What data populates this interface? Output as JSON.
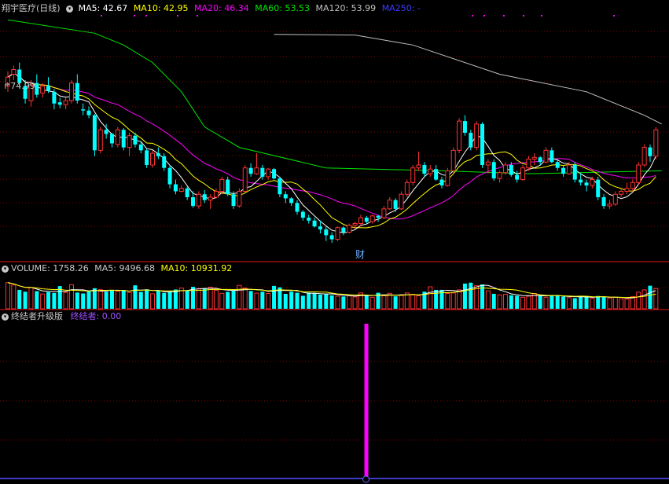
{
  "header": {
    "stock_name": "翔宇医疗",
    "period": "(日线)",
    "ma5": "MA5: 42.67",
    "ma10": "MA10: 42.95",
    "ma20": "MA20: 46.34",
    "ma60": "MA60: 53.53",
    "ma120": "MA120: 53.99",
    "ma250": "MA250: -"
  },
  "high_marker": "74.99",
  "cai_marker": "财",
  "volume_header": {
    "volume": "VOLUME: 1758.26",
    "ma5": "MA5: 9496.68",
    "ma10": "MA10: 10931.92"
  },
  "indicator_header": {
    "name": "终结者升级版",
    "value_label": "终结者: 0.00"
  },
  "colors": {
    "up": "#ff3232",
    "down": "#00ffff",
    "ma5": "#ffffff",
    "ma10": "#ffff00",
    "ma20": "#ff00ff",
    "ma60": "#00e600",
    "ma120": "#c0c0c0",
    "ma250": "#3c3cff",
    "signal": "#ff00ff"
  },
  "chart_data": {
    "type": "candlestick",
    "candles": [
      [
        64,
        66.5,
        63,
        65.5
      ],
      [
        66,
        67.5,
        65,
        66.8
      ],
      [
        66.8,
        68,
        64,
        64.5
      ],
      [
        64,
        65,
        61,
        61.8
      ],
      [
        61.5,
        65,
        60.5,
        64.2
      ],
      [
        64.5,
        66,
        62,
        62.5
      ],
      [
        62.8,
        64.5,
        62,
        64
      ],
      [
        64,
        65.5,
        62.8,
        63.2
      ],
      [
        63,
        63.5,
        60,
        61
      ],
      [
        61.2,
        62,
        60.2,
        60.8
      ],
      [
        60.8,
        62,
        60,
        61.5
      ],
      [
        61.5,
        65,
        61,
        64.5
      ],
      [
        64.5,
        66,
        61,
        61.5
      ],
      [
        60,
        61,
        59,
        59.8
      ],
      [
        59.8,
        60.5,
        58.5,
        59
      ],
      [
        59,
        59.2,
        52,
        53
      ],
      [
        53,
        57,
        52.5,
        56.5
      ],
      [
        56.5,
        57.5,
        55,
        55.8
      ],
      [
        55.8,
        56,
        53.5,
        54.2
      ],
      [
        54,
        57,
        53.5,
        56.5
      ],
      [
        56.5,
        56.8,
        53,
        53.5
      ],
      [
        53.5,
        56,
        52,
        55.5
      ],
      [
        55.5,
        56,
        53.5,
        54
      ],
      [
        54,
        54.5,
        52.5,
        53
      ],
      [
        53,
        53.3,
        50,
        50.5
      ],
      [
        50.5,
        53,
        50,
        52.5
      ],
      [
        52.5,
        53.5,
        51.5,
        52
      ],
      [
        52,
        52.5,
        49.5,
        50
      ],
      [
        50,
        50.5,
        46.5,
        47.2
      ],
      [
        47.2,
        48,
        45.5,
        46
      ],
      [
        46,
        47,
        45.8,
        46.5
      ],
      [
        46.5,
        46.8,
        44.5,
        45
      ],
      [
        45,
        46,
        43.2,
        43.5
      ],
      [
        43.5,
        46,
        43,
        45.5
      ],
      [
        45.5,
        46.2,
        44,
        44.5
      ],
      [
        44.5,
        45.5,
        43,
        45
      ],
      [
        45,
        46.5,
        44.8,
        46
      ],
      [
        46,
        48.5,
        45.5,
        48
      ],
      [
        48,
        48.5,
        45.2,
        45.5
      ],
      [
        45.5,
        46,
        43,
        43.5
      ],
      [
        43.5,
        46.5,
        43.2,
        46
      ],
      [
        46,
        50.5,
        45.8,
        50
      ],
      [
        50,
        50.8,
        48.5,
        49
      ],
      [
        49,
        52.5,
        48.8,
        50
      ],
      [
        50,
        50.5,
        48,
        48.5
      ],
      [
        48.5,
        50,
        48,
        49.8
      ],
      [
        49.8,
        50,
        48,
        48.2
      ],
      [
        48.2,
        48.5,
        45,
        45.5
      ],
      [
        45.5,
        46,
        44,
        44.8
      ],
      [
        44.8,
        45,
        43.5,
        44
      ],
      [
        44,
        44.5,
        42,
        42.5
      ],
      [
        42.5,
        42.8,
        41,
        41.5
      ],
      [
        41.5,
        42,
        40.5,
        41
      ],
      [
        41,
        41.5,
        39.8,
        40
      ],
      [
        40,
        41,
        38.8,
        39.5
      ],
      [
        39.5,
        40,
        37.5,
        38.5
      ],
      [
        38.5,
        39,
        37.2,
        37.8
      ],
      [
        37.8,
        40,
        37.5,
        39.8
      ],
      [
        39.8,
        40,
        38.5,
        39
      ],
      [
        39,
        40.5,
        38.8,
        40.2
      ],
      [
        40.2,
        40.8,
        39.5,
        40.5
      ],
      [
        40.5,
        42,
        40,
        41.5
      ],
      [
        41.5,
        41.8,
        40.5,
        40.8
      ],
      [
        40.8,
        42,
        40.5,
        41.8
      ],
      [
        41.8,
        42,
        40.8,
        41.5
      ],
      [
        41.5,
        43.5,
        41.2,
        43
      ],
      [
        43,
        45,
        42.8,
        44.5
      ],
      [
        44.5,
        44.8,
        42.5,
        43
      ],
      [
        43,
        46,
        42.8,
        45.5
      ],
      [
        45.5,
        48,
        45,
        47.5
      ],
      [
        47.5,
        50.5,
        47,
        50
      ],
      [
        50,
        52.8,
        49.5,
        50.5
      ],
      [
        50.5,
        51,
        48.5,
        49
      ],
      [
        49,
        50.5,
        48.5,
        49.8
      ],
      [
        49.8,
        50.5,
        47.8,
        48
      ],
      [
        48,
        48.5,
        46.5,
        47
      ],
      [
        47,
        50,
        46.8,
        49.5
      ],
      [
        49.5,
        53.5,
        49,
        53
      ],
      [
        53,
        58.5,
        52.5,
        58
      ],
      [
        58,
        59,
        55.5,
        56
      ],
      [
        56,
        56.5,
        53,
        53.5
      ],
      [
        53.5,
        58,
        53,
        57.5
      ],
      [
        57.5,
        57.8,
        50,
        50.5
      ],
      [
        50.5,
        51.5,
        49,
        51
      ],
      [
        51,
        51.5,
        47.8,
        48.2
      ],
      [
        48.2,
        49.5,
        47.5,
        49.2
      ],
      [
        49.2,
        51,
        48.8,
        50.5
      ],
      [
        50.5,
        51,
        48.5,
        48.8
      ],
      [
        48.8,
        49.5,
        47.5,
        48
      ],
      [
        48,
        50.5,
        47.8,
        50
      ],
      [
        50,
        52,
        49.5,
        51.5
      ],
      [
        51.5,
        52.5,
        50.5,
        51.8
      ],
      [
        51.8,
        52,
        50.5,
        51
      ],
      [
        51,
        53.5,
        50.8,
        53
      ],
      [
        53,
        53.5,
        50.8,
        51
      ],
      [
        51,
        51.5,
        49.5,
        50
      ],
      [
        50,
        50.5,
        48.5,
        49
      ],
      [
        49,
        51,
        48.8,
        50.5
      ],
      [
        50.5,
        51,
        47.5,
        48
      ],
      [
        48,
        49,
        47,
        47.5
      ],
      [
        47.5,
        48,
        46,
        47
      ],
      [
        47,
        48.5,
        46.5,
        48
      ],
      [
        48,
        48.5,
        44.5,
        45
      ],
      [
        45,
        45.5,
        43,
        43.5
      ],
      [
        43.5,
        44.5,
        43,
        43.8
      ],
      [
        43.8,
        46,
        43.5,
        45.5
      ],
      [
        45.5,
        46.5,
        45,
        46
      ],
      [
        46,
        47.5,
        45.5,
        46.5
      ],
      [
        46.5,
        48,
        46,
        47.5
      ],
      [
        47.5,
        51,
        47.2,
        50.5
      ],
      [
        50.5,
        54,
        50.2,
        53.5
      ],
      [
        53.5,
        54,
        51,
        52
      ],
      [
        52,
        57,
        51.5,
        56.5
      ]
    ],
    "volumes": [
      1.45,
      1.32,
      1.05,
      0.95,
      1.18,
      0.98,
      0.82,
      0.93,
      0.88,
      1.26,
      0.91,
      1.34,
      0.9,
      0.85,
      0.96,
      1.14,
      1.06,
      0.95,
      1.02,
      0.98,
      1.04,
      0.9,
      1.3,
      0.94,
      1.08,
      0.83,
      0.98,
      0.88,
      0.95,
      1.07,
      1.15,
      1.0,
      1.22,
      1.1,
      1.15,
      1.2,
      1.03,
      0.86,
      0.94,
      1.03,
      1.3,
      1.15,
      0.99,
      0.87,
      0.95,
      0.85,
      1.27,
      1.19,
      0.83,
      0.95,
      0.89,
      0.72,
      0.9,
      0.88,
      0.79,
      0.83,
      0.74,
      0.7,
      0.68,
      0.72,
      0.66,
      0.88,
      0.76,
      0.64,
      0.89,
      0.72,
      0.86,
      0.69,
      0.74,
      0.88,
      0.8,
      0.72,
      0.95,
      1.22,
      1.05,
      1.05,
      0.85,
      0.88,
      1.05,
      1.4,
      1.45,
      1.28,
      1.35,
      1.0,
      0.83,
      0.77,
      0.8,
      0.75,
      0.72,
      0.64,
      0.7,
      0.85,
      0.75,
      0.64,
      0.74,
      0.72,
      0.68,
      0.62,
      0.59,
      0.72,
      0.68,
      0.58,
      0.71,
      0.66,
      0.6,
      0.64,
      0.55,
      0.55,
      0.68,
      0.92,
      1.05,
      1.28,
      1.12
    ],
    "y_range": [
      36,
      76
    ],
    "volume_max": 3.0,
    "ma120_segment": [
      [
        46,
        72.8
      ],
      [
        60,
        72.7
      ],
      [
        70,
        71
      ],
      [
        85,
        66
      ],
      [
        100,
        63
      ],
      [
        110,
        59
      ],
      [
        113,
        57.5
      ]
    ],
    "ma60_segment": [
      [
        0,
        75.3
      ],
      [
        15,
        73
      ],
      [
        20,
        71
      ],
      [
        25,
        68
      ],
      [
        30,
        63
      ],
      [
        34,
        57
      ],
      [
        40,
        53.5
      ],
      [
        55,
        50
      ],
      [
        75,
        49.5
      ],
      [
        90,
        49
      ],
      [
        113,
        49.5
      ]
    ],
    "signal": {
      "index": 57,
      "value": 1
    }
  }
}
